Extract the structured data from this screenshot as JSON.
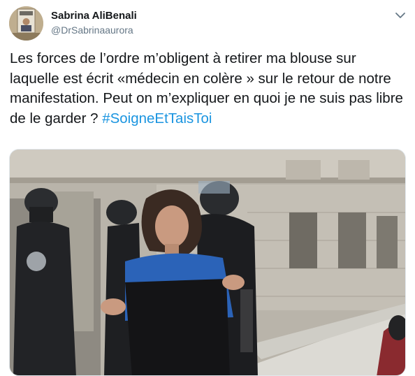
{
  "author": {
    "name": "Sabrina AliBenali",
    "handle": "@DrSabrinaaurora"
  },
  "tweet": {
    "text": "Les forces de l’ordre m’obligent à retirer ma blouse sur laquelle est écrit «médecin en colère » sur le retour de notre manifestation. Peut on m’expliquer en quoi je ne suis pas libre de le garder ? ",
    "hashtag": "#SoigneEtTaisToi"
  },
  "icons": {
    "menu": "chevron-down-icon"
  },
  "colors": {
    "link": "#1b95e0",
    "secondary": "#657786",
    "text": "#14171a"
  }
}
